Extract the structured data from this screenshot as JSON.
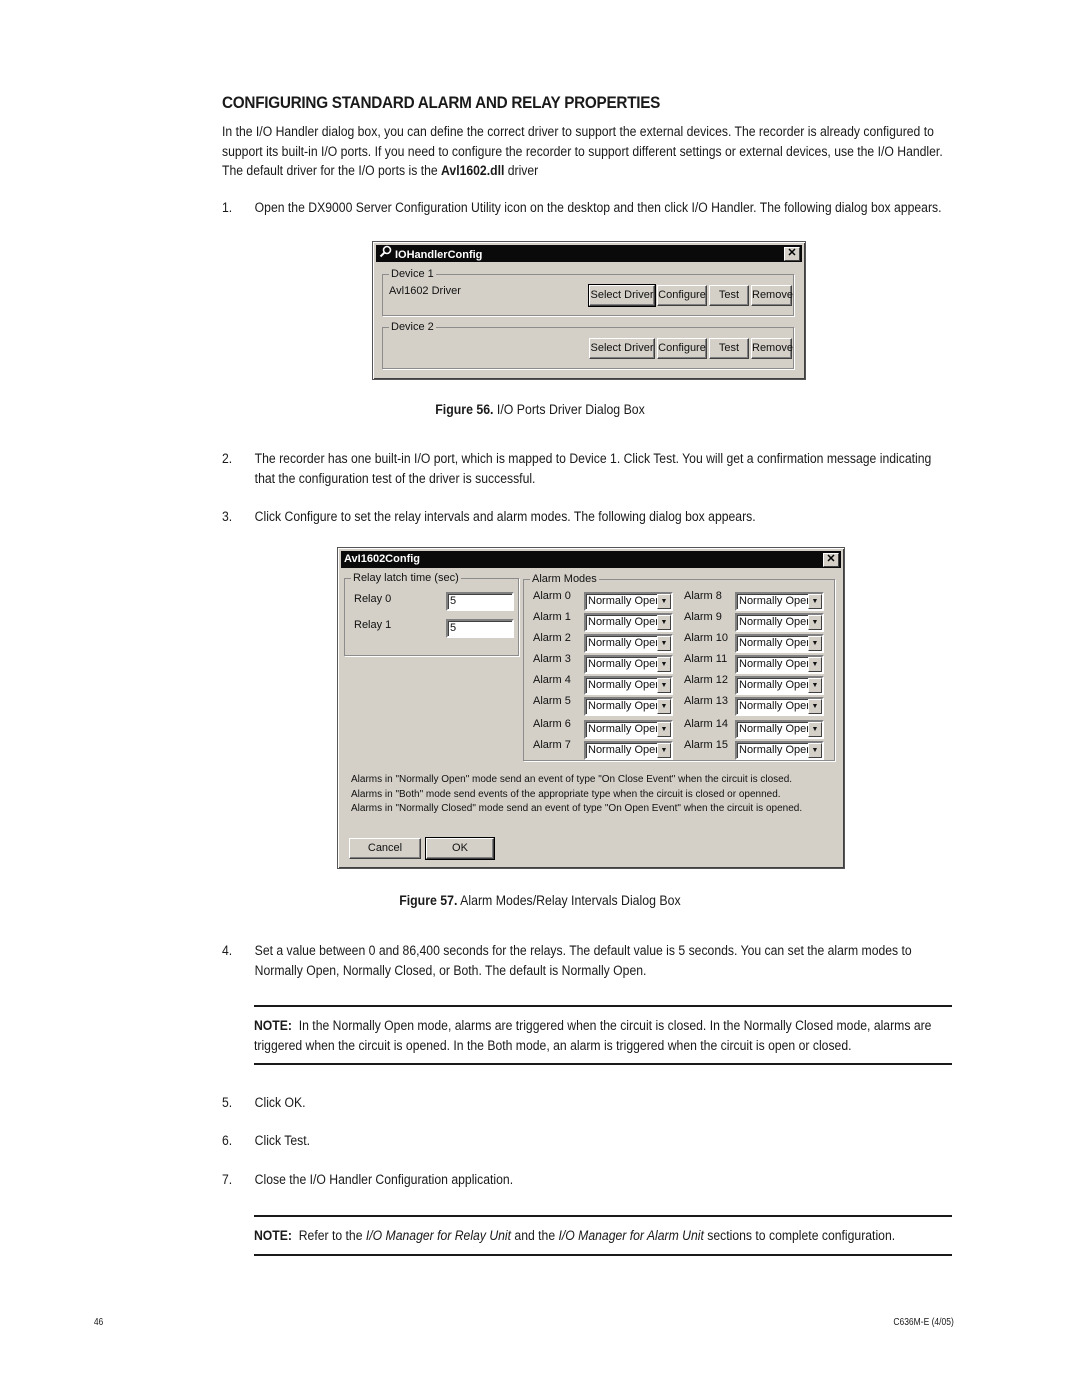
{
  "document": {
    "heading": "CONFIGURING STANDARD ALARM AND RELAY PROPERTIES",
    "intro": {
      "text_before_bold": "In the I/O Handler dialog box, you can define the correct driver to support the external devices. The recorder is already configured to support its built-in I/O ports. If you need to configure the recorder to support different settings or external devices, use the I/O Handler. The default driver for the I/O ports is the ",
      "bold": "Avl1602.dll",
      "text_after_bold": " driver"
    },
    "steps": [
      {
        "num": "1.",
        "text": "Open the DX9000 Server Configuration Utility icon on the desktop and then click I/O Handler. The following dialog box appears."
      },
      {
        "num": "2.",
        "text": "The recorder has one built-in I/O port, which is mapped to Device 1. Click Test. You will get a confirmation message indicating that the configuration test of the driver is successful."
      },
      {
        "num": "3.",
        "text": "Click Configure to set the relay intervals and alarm modes. The following dialog box appears."
      },
      {
        "num": "4.",
        "text": "Set a value between 0 and 86,400 seconds for the relays. The default value is 5 seconds. You can set the alarm modes to Normally Open, Normally Closed, or Both. The default is Normally Open."
      },
      {
        "num": "5.",
        "text": "Click OK."
      },
      {
        "num": "6.",
        "text": "Click Test."
      },
      {
        "num": "7.",
        "text": "Close the I/O Handler Configuration application."
      }
    ],
    "figure56": {
      "label": "Figure 56.",
      "title": "I/O Ports Driver Dialog Box"
    },
    "figure57": {
      "label": "Figure 57.",
      "title": "Alarm Modes/Relay Intervals Dialog Box"
    },
    "note1": {
      "label": "NOTE:",
      "text": "In the Normally Open mode, alarms are triggered when the circuit is closed. In the Normally Closed mode, alarms are triggered when the circuit is opened. In the Both mode, an alarm is triggered when the circuit is open or closed."
    },
    "note2": {
      "label": "NOTE:",
      "t1": "Refer to the ",
      "i1": "I/O Manager for Relay Unit",
      "t2": "  and the ",
      "i2": "I/O Manager for Alarm Unit",
      "t3": " sections to complete configuration."
    },
    "footer": {
      "page_number": "46",
      "doc_code": "C636M-E (4/05)"
    }
  },
  "io_handler_dialog": {
    "title": "IOHandlerConfig",
    "close_glyph": "✕",
    "devices": [
      {
        "group_label": "Device 1",
        "driver_name": "Avl1602 Driver"
      },
      {
        "group_label": "Device 2",
        "driver_name": ""
      }
    ],
    "buttons": {
      "select_driver": "Select Driver",
      "configure": "Configure",
      "test": "Test",
      "remove": "Remove"
    }
  },
  "avl_config_dialog": {
    "title": "AvI1602Config",
    "close_glyph": "✕",
    "relay_group_label": "Relay latch time (sec)",
    "relays": [
      {
        "label": "Relay 0",
        "value": "5"
      },
      {
        "label": "Relay 1",
        "value": "5"
      }
    ],
    "alarm_group_label": "Alarm Modes",
    "alarms": [
      {
        "label": "Alarm 0",
        "mode": "Normally Open"
      },
      {
        "label": "Alarm 1",
        "mode": "Normally Open"
      },
      {
        "label": "Alarm 2",
        "mode": "Normally Open"
      },
      {
        "label": "Alarm 3",
        "mode": "Normally Open"
      },
      {
        "label": "Alarm 4",
        "mode": "Normally Open"
      },
      {
        "label": "Alarm 5",
        "mode": "Normally Open"
      },
      {
        "label": "Alarm 6",
        "mode": "Normally Open"
      },
      {
        "label": "Alarm 7",
        "mode": "Normally Open"
      },
      {
        "label": "Alarm 8",
        "mode": "Normally Open"
      },
      {
        "label": "Alarm 9",
        "mode": "Normally Open"
      },
      {
        "label": "Alarm 10",
        "mode": "Normally Open"
      },
      {
        "label": "Alarm 11",
        "mode": "Normally Open"
      },
      {
        "label": "Alarm 12",
        "mode": "Normally Open"
      },
      {
        "label": "Alarm 13",
        "mode": "Normally Open"
      },
      {
        "label": "Alarm 14",
        "mode": "Normally Open"
      },
      {
        "label": "Alarm 15",
        "mode": "Normally Open"
      }
    ],
    "info_lines": [
      "Alarms in \"Normally Open\" mode send an event of type \"On Close Event\" when the circuit is closed.",
      "Alarms in \"Both\" mode send events of the appropriate type when the circuit is closed or openned.",
      "Alarms in \"Normally Closed\" mode send an event of type \"On Open Event\" when the circuit is opened."
    ],
    "cancel_label": "Cancel",
    "ok_label": "OK",
    "dropdown_glyph": "▼"
  }
}
